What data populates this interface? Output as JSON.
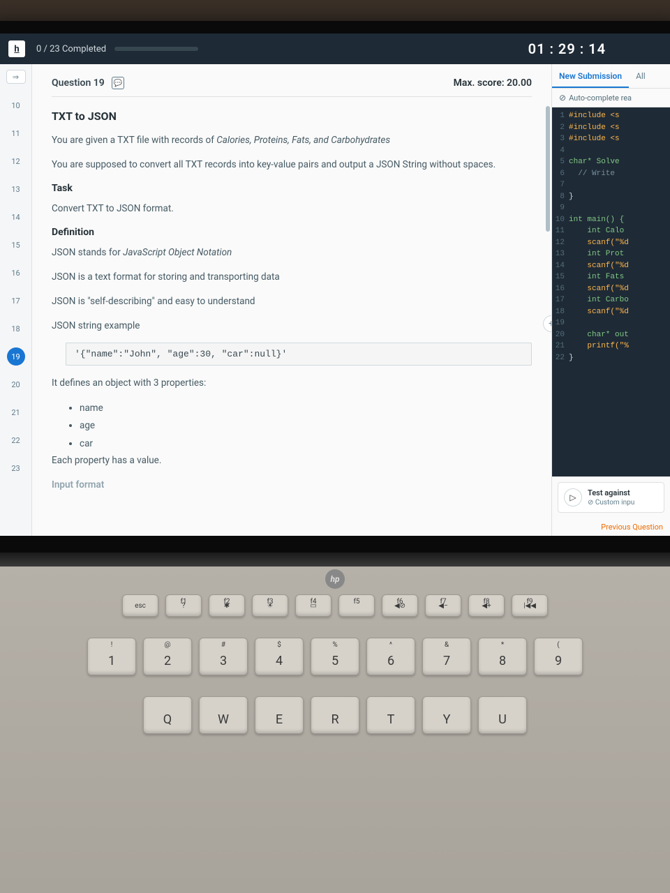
{
  "topbar": {
    "logo": "h",
    "completed": "0 / 23 Completed",
    "timer": "01 : 29 : 14"
  },
  "sidebar": {
    "collapse": "⇒",
    "items": [
      "10",
      "11",
      "12",
      "13",
      "14",
      "15",
      "16",
      "17",
      "18",
      "19",
      "20",
      "21",
      "22",
      "23"
    ],
    "active": "19"
  },
  "qheader": {
    "label": "Question  19",
    "maxscore": "Max. score: 20.00"
  },
  "problem": {
    "title": "TXT to JSON",
    "p1a": "You are given a TXT file with records of ",
    "p1b": "Calories, Proteins, Fats, and Carbohydrates",
    "p2": "You are supposed to convert all TXT records into key-value pairs and output a JSON String without spaces.",
    "task_h": "Task",
    "task_p": "Convert TXT to JSON format.",
    "def_h": "Definition",
    "def1a": "JSON stands for ",
    "def1b": "JavaScript Object Notation",
    "def2": "JSON is a text format for storing and transporting data",
    "def3": "JSON is \"self-describing\" and easy to understand",
    "ex_h": "JSON string example",
    "ex_code": "'{\"name\":\"John\", \"age\":30, \"car\":null}'",
    "after_ex": "It defines an object with 3 properties:",
    "props": [
      "name",
      "age",
      "car"
    ],
    "after_props": "Each property has a value.",
    "input_h": "Input format"
  },
  "right": {
    "tab1": "New Submission",
    "tab2": "All",
    "autocomplete": "Auto-complete rea",
    "code": [
      {
        "n": "1",
        "t": "#include <s",
        "c": "str"
      },
      {
        "n": "2",
        "t": "#include <s",
        "c": "str"
      },
      {
        "n": "3",
        "t": "#include <s",
        "c": "str"
      },
      {
        "n": "4",
        "t": "",
        "c": ""
      },
      {
        "n": "5",
        "t": "char* Solve",
        "c": "kw"
      },
      {
        "n": "6",
        "t": "  // Write",
        "c": "cmt"
      },
      {
        "n": "7",
        "t": "",
        "c": ""
      },
      {
        "n": "8",
        "t": "}",
        "c": ""
      },
      {
        "n": "9",
        "t": "",
        "c": ""
      },
      {
        "n": "10",
        "t": "int main() {",
        "c": "kw"
      },
      {
        "n": "11",
        "t": "    int Calo",
        "c": "kw"
      },
      {
        "n": "12",
        "t": "    scanf(\"%d",
        "c": "str"
      },
      {
        "n": "13",
        "t": "    int Prot",
        "c": "kw"
      },
      {
        "n": "14",
        "t": "    scanf(\"%d",
        "c": "str"
      },
      {
        "n": "15",
        "t": "    int Fats",
        "c": "kw"
      },
      {
        "n": "16",
        "t": "    scanf(\"%d",
        "c": "str"
      },
      {
        "n": "17",
        "t": "    int Carbo",
        "c": "kw"
      },
      {
        "n": "18",
        "t": "    scanf(\"%d",
        "c": "str"
      },
      {
        "n": "19",
        "t": "",
        "c": ""
      },
      {
        "n": "20",
        "t": "    char* out",
        "c": "kw"
      },
      {
        "n": "21",
        "t": "    printf(\"%",
        "c": "str"
      },
      {
        "n": "22",
        "t": "}",
        "c": ""
      }
    ],
    "test_label": "Test against",
    "test_sub": "Custom inpu",
    "prev": "Previous Question"
  },
  "keyboard": {
    "fnrow": [
      "esc",
      "?",
      "✱",
      "☀",
      "▭",
      "",
      "◀⊘",
      "◀−",
      "◀+",
      "|◀◀"
    ],
    "fnsup": [
      "",
      "f1",
      "f2",
      "f3",
      "f4",
      "f5",
      "f6",
      "f7",
      "f8",
      "f9"
    ],
    "numrow_sup": [
      "!",
      "@",
      "#",
      "$",
      "%",
      "^",
      "&",
      "*",
      "("
    ],
    "numrow": [
      "1",
      "2",
      "3",
      "4",
      "5",
      "6",
      "7",
      "8",
      "9"
    ],
    "alpharow": [
      "Q",
      "W",
      "E",
      "R",
      "T",
      "Y",
      "U"
    ]
  },
  "hp": "hp"
}
